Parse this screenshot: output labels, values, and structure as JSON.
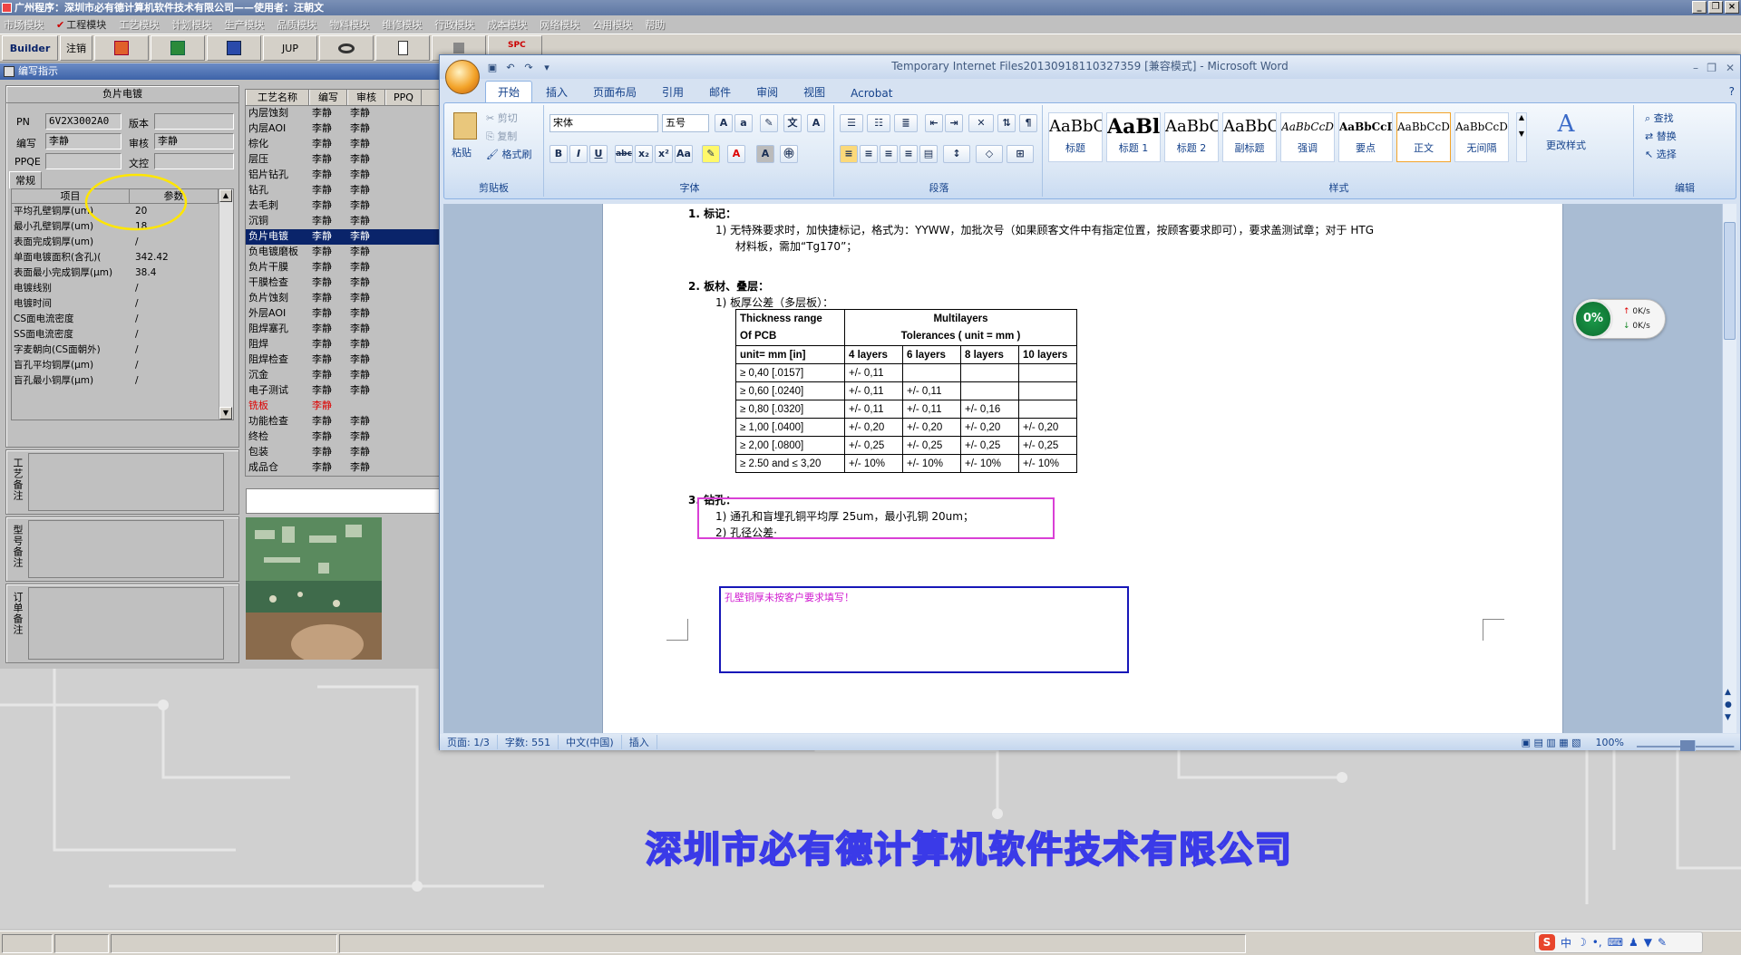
{
  "host": {
    "title": "广州程序：深圳市必有德计算机软件技术有限公司——使用者：汪朝文",
    "menu": [
      "市场模块",
      "工程模块",
      "工艺模块",
      "计划模块",
      "生产模块",
      "品质模块",
      "物料模块",
      "维修模块",
      "行政模块",
      "成本模块",
      "网络模块",
      "公用模块",
      "帮助"
    ],
    "toolbar": {
      "builder": "Builder",
      "logout": "注销",
      "jup": "JUP"
    },
    "company_banner": "深圳市必有德计算机软件技术有限公司"
  },
  "form": {
    "header": "编写指示",
    "section_title": "负片电镀",
    "labels": {
      "pn": "PN",
      "version": "版本",
      "editor": "编写",
      "reviewer": "审核",
      "ppqe": "PPQE",
      "doc_control": "文控",
      "tab_general": "常规"
    },
    "values": {
      "pn": "6V2X3002A0",
      "version": "",
      "editor": "李静",
      "reviewer": "李静",
      "ppqe": "",
      "doc_control": ""
    },
    "param_headers": [
      "项目",
      "参数"
    ],
    "params": [
      {
        "item": "平均孔壁铜厚(um)",
        "value": "20"
      },
      {
        "item": "最小孔壁铜厚(um)",
        "value": "18"
      },
      {
        "item": "表面完成铜厚(um)",
        "value": "/"
      },
      {
        "item": "单面电镀面积(含孔)(",
        "value": "342.42"
      },
      {
        "item": "表面最小完成铜厚(μm)",
        "value": "38.4"
      },
      {
        "item": "电镀线别",
        "value": "/"
      },
      {
        "item": "电镀时间",
        "value": "/"
      },
      {
        "item": "CS面电流密度",
        "value": "/"
      },
      {
        "item": "SS面电流密度",
        "value": "/"
      },
      {
        "item": "字麦朝向(CS面朝外)",
        "value": "/"
      },
      {
        "item": "盲孔平均铜厚(μm)",
        "value": "/"
      },
      {
        "item": "盲孔最小铜厚(μm)",
        "value": "/"
      }
    ],
    "note_labels": [
      "工艺备注",
      "型号备注",
      "订单备注"
    ]
  },
  "process": {
    "headers": [
      "工艺名称",
      "编写",
      "审核",
      "PPQ"
    ],
    "rows": [
      [
        "内层蚀刻",
        "李静",
        "李静"
      ],
      [
        "内层AOI",
        "李静",
        "李静"
      ],
      [
        "棕化",
        "李静",
        "李静"
      ],
      [
        "层压",
        "李静",
        "李静"
      ],
      [
        "铝片钻孔",
        "李静",
        "李静"
      ],
      [
        "钻孔",
        "李静",
        "李静"
      ],
      [
        "去毛刺",
        "李静",
        "李静"
      ],
      [
        "沉铜",
        "李静",
        "李静"
      ],
      [
        "负片电镀",
        "李静",
        "李静"
      ],
      [
        "负电镀磨板",
        "李静",
        "李静"
      ],
      [
        "负片干膜",
        "李静",
        "李静"
      ],
      [
        "干膜检查",
        "李静",
        "李静"
      ],
      [
        "负片蚀刻",
        "李静",
        "李静"
      ],
      [
        "外层AOI",
        "李静",
        "李静"
      ],
      [
        "阻焊塞孔",
        "李静",
        "李静"
      ],
      [
        "阻焊",
        "李静",
        "李静"
      ],
      [
        "阻焊检查",
        "李静",
        "李静"
      ],
      [
        "沉金",
        "李静",
        "李静"
      ],
      [
        "电子测试",
        "李静",
        "李静"
      ],
      [
        "铣板",
        "李静",
        ""
      ],
      [
        "功能检查",
        "李静",
        "李静"
      ],
      [
        "终检",
        "李静",
        "李静"
      ],
      [
        "包装",
        "李静",
        "李静"
      ],
      [
        "成品仓",
        "李静",
        "李静"
      ]
    ],
    "selected_index": 8,
    "highlight_index": 19
  },
  "word": {
    "title": "Temporary Internet Files20130918110327359 [兼容模式] - Microsoft Word",
    "tabs": [
      "开始",
      "插入",
      "页面布局",
      "引用",
      "邮件",
      "审阅",
      "视图",
      "Acrobat"
    ],
    "clipboard": {
      "paste": "粘贴",
      "cut": "剪切",
      "copy": "复制",
      "format_painter": "格式刷",
      "label": "剪贴板"
    },
    "font": {
      "name": "宋体",
      "size": "五号",
      "label": "字体"
    },
    "paragraph_label": "段落",
    "styles": [
      {
        "sample": "AaBbC",
        "name": "标题"
      },
      {
        "sample": "AaBl",
        "name": "标题 1"
      },
      {
        "sample": "AaBbC",
        "name": "标题 2"
      },
      {
        "sample": "AaBbC",
        "name": "副标题"
      },
      {
        "sample": "AaBbCcD",
        "name": "强调"
      },
      {
        "sample": "AaBbCcD",
        "name": "要点"
      },
      {
        "sample": "AaBbCcDc",
        "name": "正文"
      },
      {
        "sample": "AaBbCcDc",
        "name": "无间隔"
      }
    ],
    "styles_label": "样式",
    "change_styles": "更改样式",
    "editing": {
      "find": "查找",
      "replace": "替换",
      "select": "选择",
      "label": "编辑"
    },
    "doc": {
      "h1": "1.  标记：",
      "h1_item": "1)  无特殊要求时，加快捷标记，格式为：YYWW，加批次号（如果顾客文件中有指定位置，按顾客要求即可），要求盖测试章；对于 HTG",
      "h1_item_cont": "材料板，需加“Tg170”；",
      "h2": "2.  板材、叠层：",
      "h2_item": "1)  板厚公差（多层板）：",
      "table": {
        "head1": [
          "Thickness range",
          "Multilayers"
        ],
        "head2": [
          "Of PCB",
          "Tolerances ( unit = mm )"
        ],
        "head3": [
          "unit= mm [in]",
          "4 layers",
          "6 layers",
          "8 layers",
          "10 layers"
        ],
        "rows": [
          [
            "≥ 0,40 [.0157]",
            "+/- 0,11",
            "",
            "",
            ""
          ],
          [
            "≥ 0,60 [.0240]",
            "+/- 0,11",
            "+/- 0,11",
            "",
            ""
          ],
          [
            "≥ 0,80 [.0320]",
            "+/- 0,11",
            "+/- 0,11",
            "+/- 0,16",
            ""
          ],
          [
            "≥ 1,00  [.0400]",
            "+/- 0,20",
            "+/- 0,20",
            "+/- 0,20",
            "+/- 0,20"
          ],
          [
            "≥ 2,00  [.0800]",
            "+/- 0,25",
            "+/- 0,25",
            "+/- 0,25",
            "+/- 0,25"
          ],
          [
            "≥ 2.50 and  ≤ 3,20",
            "+/- 10%",
            "+/- 10%",
            "+/- 10%",
            "+/- 10%"
          ]
        ]
      },
      "h3": "3.  钻孔：",
      "h3_item1": "1)  通孔和盲埋孔铜平均厚 25um，最小孔铜 20um；",
      "h3_item2": "2)  孔径公差·",
      "comment": "孔壁铜厚未按客户要求填写！"
    },
    "status": {
      "page": "页面: 1/3",
      "words": "字数: 551",
      "lang": "中文(中国)",
      "mode": "插入",
      "zoom": "100%"
    }
  },
  "net_widget": {
    "percent": "0%",
    "up": "0K/s",
    "down": "0K/s"
  },
  "ime": {
    "mode": "中"
  }
}
